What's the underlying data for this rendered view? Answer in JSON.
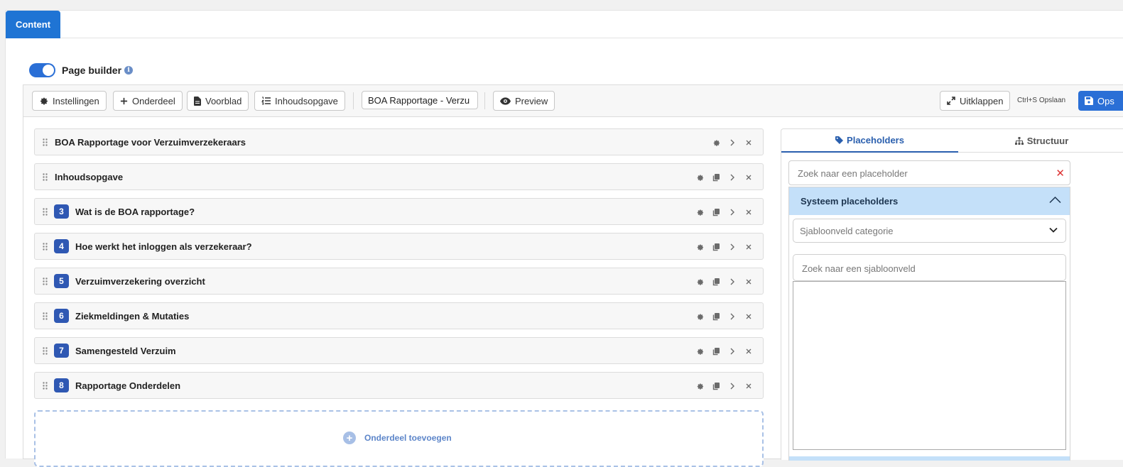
{
  "tabs": {
    "content": "Content"
  },
  "page_builder": {
    "label": "Page builder",
    "info": "i"
  },
  "toolbar": {
    "settings": "Instellingen",
    "add_section": "Onderdeel",
    "cover": "Voorblad",
    "toc": "Inhoudsopgave",
    "title_value": "BOA Rapportage - Verzu",
    "preview": "Preview",
    "expand": "Uitklappen",
    "shortcut": "Ctrl+S Opslaan",
    "save": "Ops"
  },
  "sections": [
    {
      "number": "",
      "title": "BOA Rapportage voor Verzuimverzekeraars"
    },
    {
      "number": "",
      "title": "Inhoudsopgave"
    },
    {
      "number": "3",
      "title": "Wat is de BOA rapportage?"
    },
    {
      "number": "4",
      "title": "Hoe werkt het inloggen als verzekeraar?"
    },
    {
      "number": "5",
      "title": "Verzuimverzekering overzicht"
    },
    {
      "number": "6",
      "title": "Ziekmeldingen & Mutaties"
    },
    {
      "number": "7",
      "title": "Samengesteld Verzuim"
    },
    {
      "number": "8",
      "title": "Rapportage Onderdelen"
    }
  ],
  "add_section": {
    "label": "Onderdeel toevoegen"
  },
  "panel": {
    "tab_placeholders": "Placeholders",
    "tab_structure": "Structuur",
    "search_placeholder": "Zoek naar een placeholder",
    "clear": "✕",
    "group_title": "Systeem placeholders",
    "category_placeholder": "Sjabloonveld categorie",
    "field_search_placeholder": "Zoek naar een sjabloonveld"
  },
  "colors": {
    "accent": "#2a6fd6",
    "badge": "#2f58b3",
    "group_header": "#c4e0f9"
  }
}
